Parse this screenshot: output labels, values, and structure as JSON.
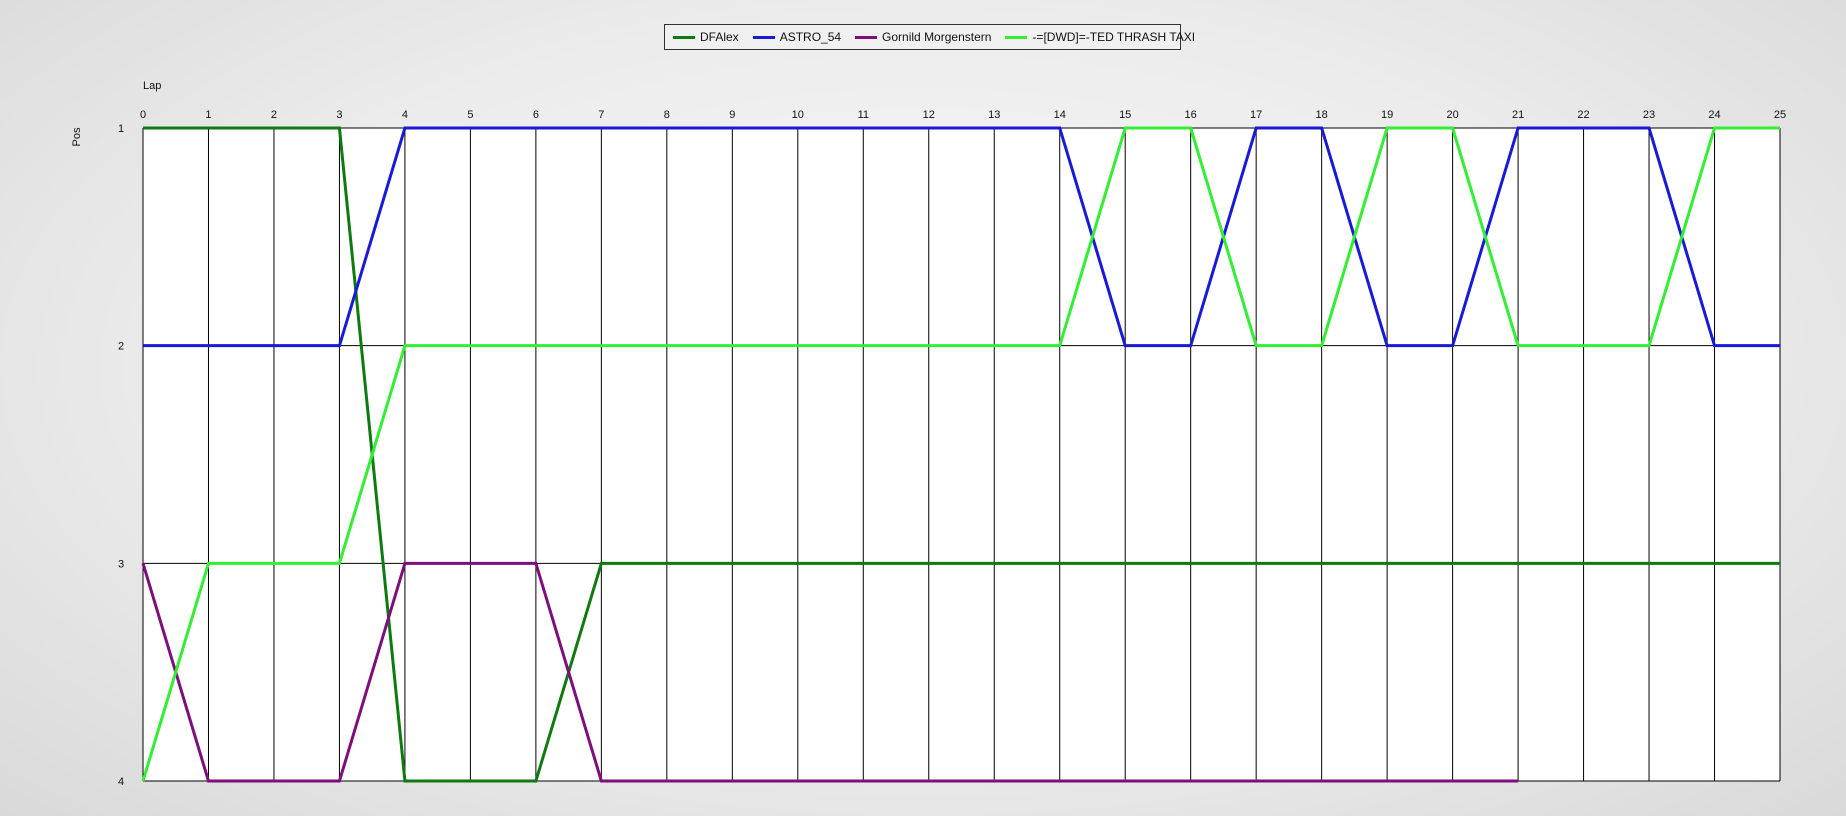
{
  "chart_data": {
    "type": "line",
    "xlabel": "Lap",
    "ylabel": "Pos",
    "x": [
      0,
      1,
      2,
      3,
      4,
      5,
      6,
      7,
      8,
      9,
      10,
      11,
      12,
      13,
      14,
      15,
      16,
      17,
      18,
      19,
      20,
      21,
      22,
      23,
      24,
      25
    ],
    "xlim": [
      0,
      25
    ],
    "ylim": [
      1,
      4
    ],
    "y_inverted": true,
    "y_ticks": [
      1,
      2,
      3,
      4
    ],
    "grid": true,
    "legend_position": "top-center",
    "series": [
      {
        "name": "DFAlex",
        "color": "#0f7a0f",
        "values": [
          1,
          1,
          1,
          1,
          4,
          4,
          4,
          3,
          3,
          3,
          3,
          3,
          3,
          3,
          3,
          3,
          3,
          3,
          3,
          3,
          3,
          3,
          3,
          3,
          3,
          3
        ]
      },
      {
        "name": "ASTRO_54",
        "color": "#1a1ad6",
        "values": [
          2,
          2,
          2,
          2,
          1,
          1,
          1,
          1,
          1,
          1,
          1,
          1,
          1,
          1,
          1,
          2,
          2,
          1,
          1,
          2,
          2,
          1,
          1,
          1,
          2,
          2
        ]
      },
      {
        "name": "Gornild Morgenstern",
        "color": "#7d0f7d",
        "values": [
          3,
          4,
          4,
          4,
          3,
          3,
          3,
          4,
          4,
          4,
          4,
          4,
          4,
          4,
          4,
          4,
          4,
          4,
          4,
          4,
          4,
          4
        ]
      },
      {
        "name": "-=[DWD]=-TED THRASH TAXI",
        "color": "#33ee33",
        "values": [
          4,
          3,
          3,
          3,
          2,
          2,
          2,
          2,
          2,
          2,
          2,
          2,
          2,
          2,
          2,
          1,
          1,
          2,
          2,
          1,
          1,
          2,
          2,
          2,
          1,
          1
        ]
      }
    ]
  }
}
